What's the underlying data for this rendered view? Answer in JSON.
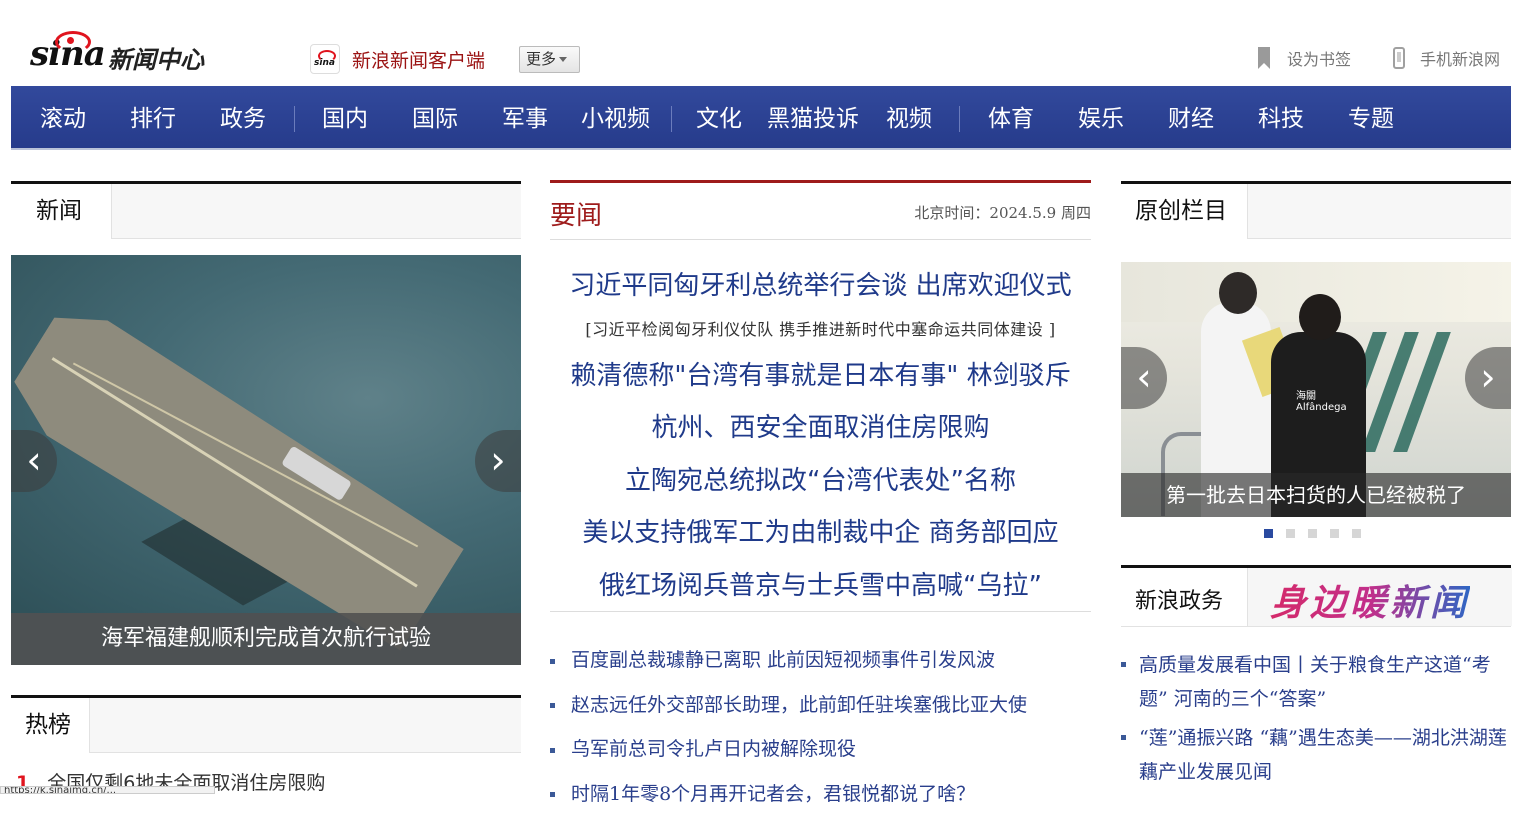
{
  "header": {
    "logo_sina": "sina",
    "logo_section": "新闻中心",
    "client_label": "新浪新闻客户端",
    "more_label": "更多",
    "bookmark_label": "设为书签",
    "mobile_label": "手机新浪网"
  },
  "nav": {
    "items": [
      "滚动",
      "排行",
      "政务",
      "国内",
      "国际",
      "军事",
      "小视频",
      "文化",
      "黑猫投诉",
      "视频",
      "体育",
      "娱乐",
      "财经",
      "科技",
      "专题"
    ]
  },
  "left": {
    "news_tab": "新闻",
    "slide_caption": "海军福建舰顺利完成首次航行试验",
    "hot_tab": "热榜",
    "hot_items": [
      {
        "rank": "1",
        "title": "全国仅剩6地未全面取消住房限购"
      }
    ]
  },
  "middle": {
    "title": "要闻",
    "clock": "北京时间：2024.5.9 周四",
    "headlines": [
      "习近平同匈牙利总统举行会谈 出席欢迎仪式",
      "赖清德称\"台湾有事就是日本有事\" 林剑驳斥",
      "杭州、西安全面取消住房限购",
      "立陶宛总统拟改“台湾代表处”名称",
      "美以支持俄军工为由制裁中企 商务部回应",
      "俄红场阅兵普京与士兵雪中高喊“乌拉”"
    ],
    "sub_headline": "[习近平检阅匈牙利仪仗队 携手推进新时代中塞命运共同体建设 ]",
    "list": [
      "百度副总裁璩静已离职 此前因短视频事件引发风波",
      "赵志远任外交部部长助理，此前卸任驻埃塞俄比亚大使",
      "乌军前总司令扎卢日内被解除现役",
      "时隔1年零8个月再开记者会，君银悦都说了啥？"
    ]
  },
  "right": {
    "original_tab": "原创栏目",
    "slide_caption": "第一批去日本扫货的人已经被税了",
    "slide_badge": "海關",
    "slide_badge_sub": "Alfândega",
    "gov_tab": "新浪政务",
    "gov_slogan": "身边暖新闻",
    "list": [
      "高质量发展看中国丨关于粮食生产这道“考题” 河南的三个“答案”",
      "“莲”通振兴路 “藕”遇生态美——湖北洪湖莲藕产业发展见闻"
    ]
  },
  "status_bar": "https://k.sinaimg.cn/...",
  "colors": {
    "nav_bg": "#2c4393",
    "headline_blue": "#1f3a8a",
    "accent_red": "#9e1b1b"
  }
}
